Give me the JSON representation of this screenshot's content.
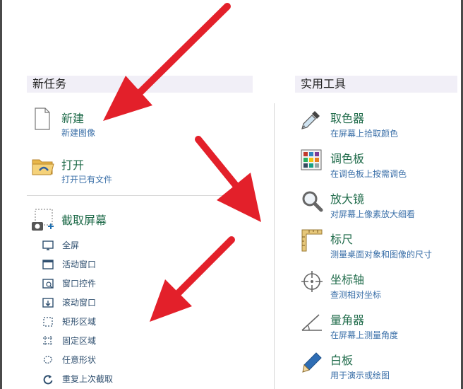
{
  "sections": {
    "left_title": "新任务",
    "right_title": "实用工具"
  },
  "new_task": {
    "new": {
      "title": "新建",
      "subtitle": "新建图像"
    },
    "open": {
      "title": "打开",
      "subtitle": "打开已有文件"
    },
    "capture": {
      "title": "截取屏幕",
      "items": [
        {
          "label": "全屏",
          "icon": "monitor-icon"
        },
        {
          "label": "活动窗口",
          "icon": "window-icon"
        },
        {
          "label": "窗口控件",
          "icon": "window-control-icon"
        },
        {
          "label": "滚动窗口",
          "icon": "scroll-window-icon"
        },
        {
          "label": "矩形区域",
          "icon": "rectangle-select-icon"
        },
        {
          "label": "固定区域",
          "icon": "fixed-region-icon"
        },
        {
          "label": "任意形状",
          "icon": "freeform-icon"
        },
        {
          "label": "重复上次截取",
          "icon": "repeat-icon"
        }
      ]
    }
  },
  "tools": [
    {
      "title": "取色器",
      "subtitle": "在屏幕上拾取颜色",
      "icon": "eyedropper-icon"
    },
    {
      "title": "调色板",
      "subtitle": "在调色板上按需调色",
      "icon": "palette-icon"
    },
    {
      "title": "放大镜",
      "subtitle": "对屏幕上像素放大细看",
      "icon": "magnifier-icon"
    },
    {
      "title": "标尺",
      "subtitle": "测量桌面对象和图像的尺寸",
      "icon": "ruler-icon"
    },
    {
      "title": "坐标轴",
      "subtitle": "查测相对坐标",
      "icon": "crosshair-icon"
    },
    {
      "title": "量角器",
      "subtitle": "在屏幕上测量角度",
      "icon": "protractor-icon"
    },
    {
      "title": "白板",
      "subtitle": "用于演示或绘图",
      "icon": "pen-icon"
    }
  ],
  "colors": {
    "title": "#1f6b4a",
    "subtitle": "#3a6fa8",
    "header_bg": "#f1eff7",
    "arrow": "#e3202a"
  }
}
